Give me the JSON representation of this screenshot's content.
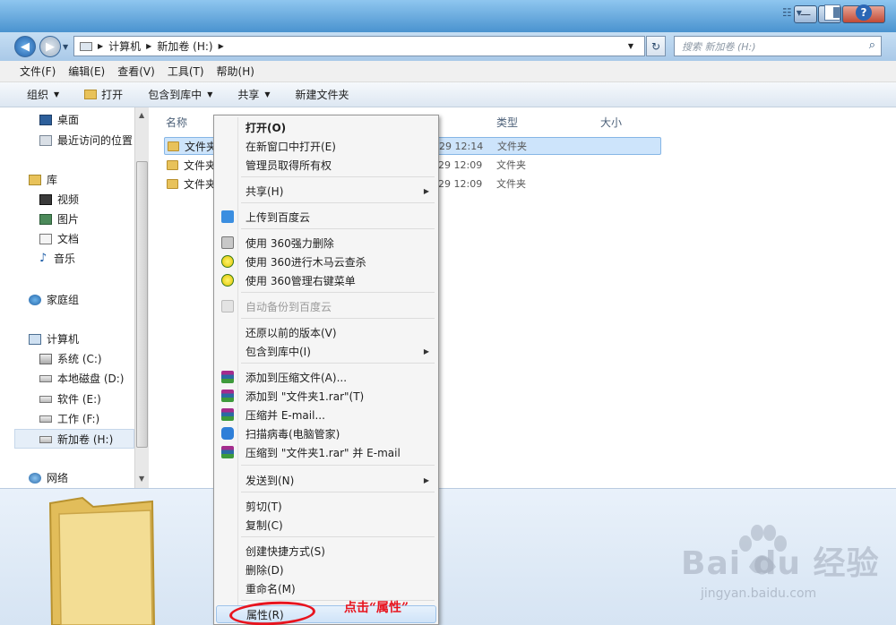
{
  "address_bar": {
    "crumbs": [
      "计算机",
      "新加卷 (H:)"
    ]
  },
  "search": {
    "placeholder": "搜索 新加卷 (H:)"
  },
  "window_controls": {
    "minimize": "—",
    "maximize": "☐",
    "close": "✕"
  },
  "menubar": [
    "文件(F)",
    "编辑(E)",
    "查看(V)",
    "工具(T)",
    "帮助(H)"
  ],
  "toolbar": {
    "organize": "组织",
    "open": "打开",
    "include": "包含到库中",
    "share": "共享",
    "new_folder": "新建文件夹"
  },
  "nav": {
    "favorites": [
      "桌面",
      "最近访问的位置"
    ],
    "library": "库",
    "library_items": [
      "视频",
      "图片",
      "文档",
      "音乐"
    ],
    "homegroup": "家庭组",
    "computer": "计算机",
    "drives": [
      "系统 (C:)",
      "本地磁盘 (D:)",
      "软件 (E:)",
      "工作 (F:)",
      "新加卷 (H:)"
    ],
    "network": "网络"
  },
  "columns": {
    "name": "名称",
    "type": "类型",
    "size": "大小"
  },
  "files": [
    {
      "name": "文件夹",
      "date": "29 12:14",
      "type": "文件夹"
    },
    {
      "name": "文件夹",
      "date": "29 12:09",
      "type": "文件夹"
    },
    {
      "name": "文件夹",
      "date": "29 12:09",
      "type": "文件夹"
    }
  ],
  "context_menu": {
    "open": "打开(O)",
    "open_new_window": "在新窗口中打开(E)",
    "take_ownership": "管理员取得所有权",
    "share": "共享(H)",
    "upload_baidu": "上传到百度云",
    "force_delete_360": "使用 360强力删除",
    "trojan_scan_360": "使用 360进行木马云查杀",
    "manage_menu_360": "使用 360管理右键菜单",
    "auto_backup_baidu": "自动备份到百度云",
    "restore_versions": "还原以前的版本(V)",
    "include_library": "包含到库中(I)",
    "add_archive": "添加到压缩文件(A)...",
    "add_to_rar": "添加到 \"文件夹1.rar\"(T)",
    "compress_email": "压缩并 E-mail...",
    "scan_virus": "扫描病毒(电脑管家)",
    "compress_rar_email": "压缩到 \"文件夹1.rar\" 并 E-mail",
    "send_to": "发送到(N)",
    "cut": "剪切(T)",
    "copy": "复制(C)",
    "create_shortcut": "创建快捷方式(S)",
    "delete": "删除(D)",
    "rename": "重命名(M)",
    "properties": "属性(R)"
  },
  "annotation": "点击“属性”",
  "watermark": {
    "brand": "Bai du 经验",
    "url": "jingyan.baidu.com"
  },
  "colors": {
    "highlight_red": "#e8141e",
    "selection": "#cde4fb",
    "titlebar": "#4a93cf"
  }
}
